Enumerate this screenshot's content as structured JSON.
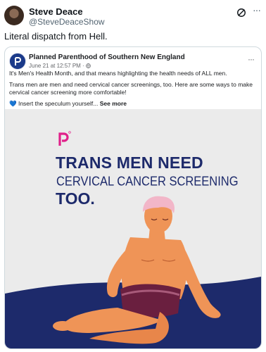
{
  "tweet": {
    "author_name": "Steve Deace",
    "author_handle": "@SteveDeaceShow",
    "text": "Literal dispatch from Hell.",
    "more_glyph": "···"
  },
  "facebook_post": {
    "page_name": "Planned Parenthood of Southern New England",
    "date": "June 21 at 12:57 PM · ",
    "more_glyph": "···",
    "paragraph_1": "It's Men's Health Month, and that means highlighting the health needs of ALL men.",
    "paragraph_2": "Trans men are men and need cervical cancer screenings, too. Here are some ways to make cervical cancer screening more comfortable!",
    "paragraph_3": "Insert the speculum yourself...",
    "see_more": "See more"
  },
  "graphic": {
    "headline_line_1": "TRANS MEN NEED",
    "headline_line_2": "CERVICAL CANCER SCREENING",
    "headline_line_3": "TOO.",
    "brand_pink": "#e0218a",
    "navy": "#1d2a6b",
    "background": "#ebebeb"
  },
  "icons": [
    "grok-icon",
    "more-icon",
    "globe-icon",
    "heart-icon",
    "planned-parenthood-logo"
  ]
}
